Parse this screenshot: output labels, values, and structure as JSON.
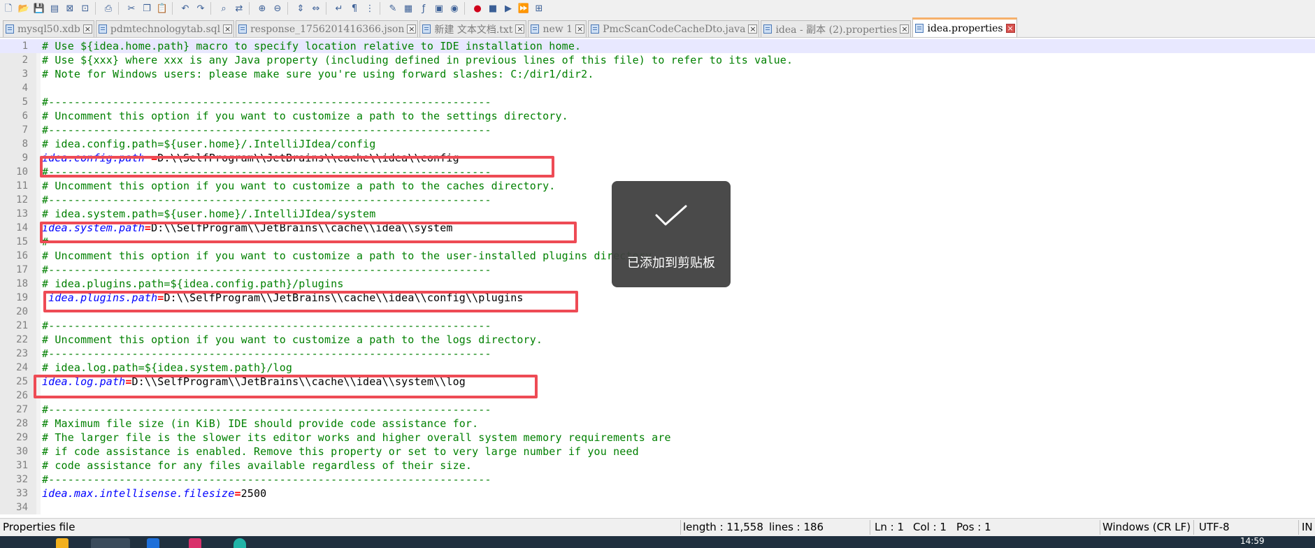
{
  "toolbar": {
    "icons": [
      "new-file",
      "open-file",
      "save",
      "save-all",
      "close",
      "close-all",
      "print",
      "cut",
      "copy",
      "paste",
      "undo",
      "redo",
      "find",
      "replace",
      "zoom-in",
      "zoom-out",
      "sync-v",
      "sync-h",
      "word-wrap",
      "show-all",
      "indent-guide",
      "udl",
      "doc-map",
      "function-list",
      "folder-workspace",
      "monitoring",
      "record-macro",
      "stop-macro",
      "play-macro",
      "run-macro-multiple",
      "save-macro"
    ]
  },
  "tabs": [
    {
      "label": "mysql50.xdb"
    },
    {
      "label": "pdmtechnologytab.sql"
    },
    {
      "label": "response_1756201416366.json"
    },
    {
      "label": "新建 文本文档.txt"
    },
    {
      "label": "new 1"
    },
    {
      "label": "PmcScanCodeCacheDto.java"
    },
    {
      "label": "idea - 副本 (2).properties"
    },
    {
      "label": "idea.properties"
    }
  ],
  "editor": {
    "lines": [
      {
        "n": "1",
        "text": "# Use ${idea.home.path} macro to specify location relative to IDE installation home."
      },
      {
        "n": "2",
        "text": "# Use ${xxx} where xxx is any Java property (including defined in previous lines of this file) to refer to its value."
      },
      {
        "n": "3",
        "text": "# Note for Windows users: please make sure you're using forward slashes: C:/dir1/dir2."
      },
      {
        "n": "4",
        "text": ""
      },
      {
        "n": "5",
        "text": "#---------------------------------------------------------------------"
      },
      {
        "n": "6",
        "text": "# Uncomment this option if you want to customize a path to the settings directory."
      },
      {
        "n": "7",
        "text": "#---------------------------------------------------------------------"
      },
      {
        "n": "8",
        "text": "# idea.config.path=${user.home}/.IntelliJIdea/config"
      },
      {
        "n": "9",
        "key": "idea.config.path ",
        "eq": "=",
        "val": "D:\\\\SelfProgram\\\\JetBrains\\\\cache\\\\idea\\\\config"
      },
      {
        "n": "10",
        "text": "#---------------------------------------------------------------------"
      },
      {
        "n": "11",
        "text": "# Uncomment this option if you want to customize a path to the caches directory."
      },
      {
        "n": "12",
        "text": "#---------------------------------------------------------------------"
      },
      {
        "n": "13",
        "text": "# idea.system.path=${user.home}/.IntelliJIdea/system"
      },
      {
        "n": "14",
        "key": "idea.system.path",
        "eq": "=",
        "val": "D:\\\\SelfProgram\\\\JetBrains\\\\cache\\\\idea\\\\system"
      },
      {
        "n": "15",
        "text": "#---------------------------------------------------------------------"
      },
      {
        "n": "16",
        "text": "# Uncomment this option if you want to customize a path to the user-installed plugins directory."
      },
      {
        "n": "17",
        "text": "#---------------------------------------------------------------------"
      },
      {
        "n": "18",
        "text": "# idea.plugins.path=${idea.config.path}/plugins"
      },
      {
        "n": "19",
        "key": " idea.plugins.path",
        "eq": "=",
        "val": "D:\\\\SelfProgram\\\\JetBrains\\\\cache\\\\idea\\\\config\\\\plugins"
      },
      {
        "n": "20",
        "text": ""
      },
      {
        "n": "21",
        "text": "#---------------------------------------------------------------------"
      },
      {
        "n": "22",
        "text": "# Uncomment this option if you want to customize a path to the logs directory."
      },
      {
        "n": "23",
        "text": "#---------------------------------------------------------------------"
      },
      {
        "n": "24",
        "text": "# idea.log.path=${idea.system.path}/log"
      },
      {
        "n": "25",
        "key": "idea.log.path",
        "eq": "=",
        "val": "D:\\\\SelfProgram\\\\JetBrains\\\\cache\\\\idea\\\\system\\\\log"
      },
      {
        "n": "26",
        "text": ""
      },
      {
        "n": "27",
        "text": "#---------------------------------------------------------------------"
      },
      {
        "n": "28",
        "text": "# Maximum file size (in KiB) IDE should provide code assistance for."
      },
      {
        "n": "29",
        "text": "# The larger file is the slower its editor works and higher overall system memory requirements are"
      },
      {
        "n": "30",
        "text": "# if code assistance is enabled. Remove this property or set to very large number if you need"
      },
      {
        "n": "31",
        "text": "# code assistance for any files available regardless of their size."
      },
      {
        "n": "32",
        "text": "#---------------------------------------------------------------------"
      },
      {
        "n": "33",
        "key": "idea.max.intellisense.filesize",
        "eq": "=",
        "val": "2500"
      },
      {
        "n": "34",
        "text": ""
      }
    ]
  },
  "toast": {
    "message": "已添加到剪贴板"
  },
  "status": {
    "file_type": "Properties file",
    "length": "length : 11,558",
    "lines": "lines : 186",
    "ln": "Ln : 1",
    "col": "Col : 1",
    "pos": "Pos : 1",
    "eol": "Windows (CR LF)",
    "encoding": "UTF-8",
    "mode": "IN"
  },
  "taskbar": {
    "clock": "14:59"
  },
  "colors": {
    "comment": "#008000",
    "key": "#0000ff",
    "operator": "#ff0000",
    "highlight_box": "#ee4b55",
    "toast_bg": "#404040"
  }
}
